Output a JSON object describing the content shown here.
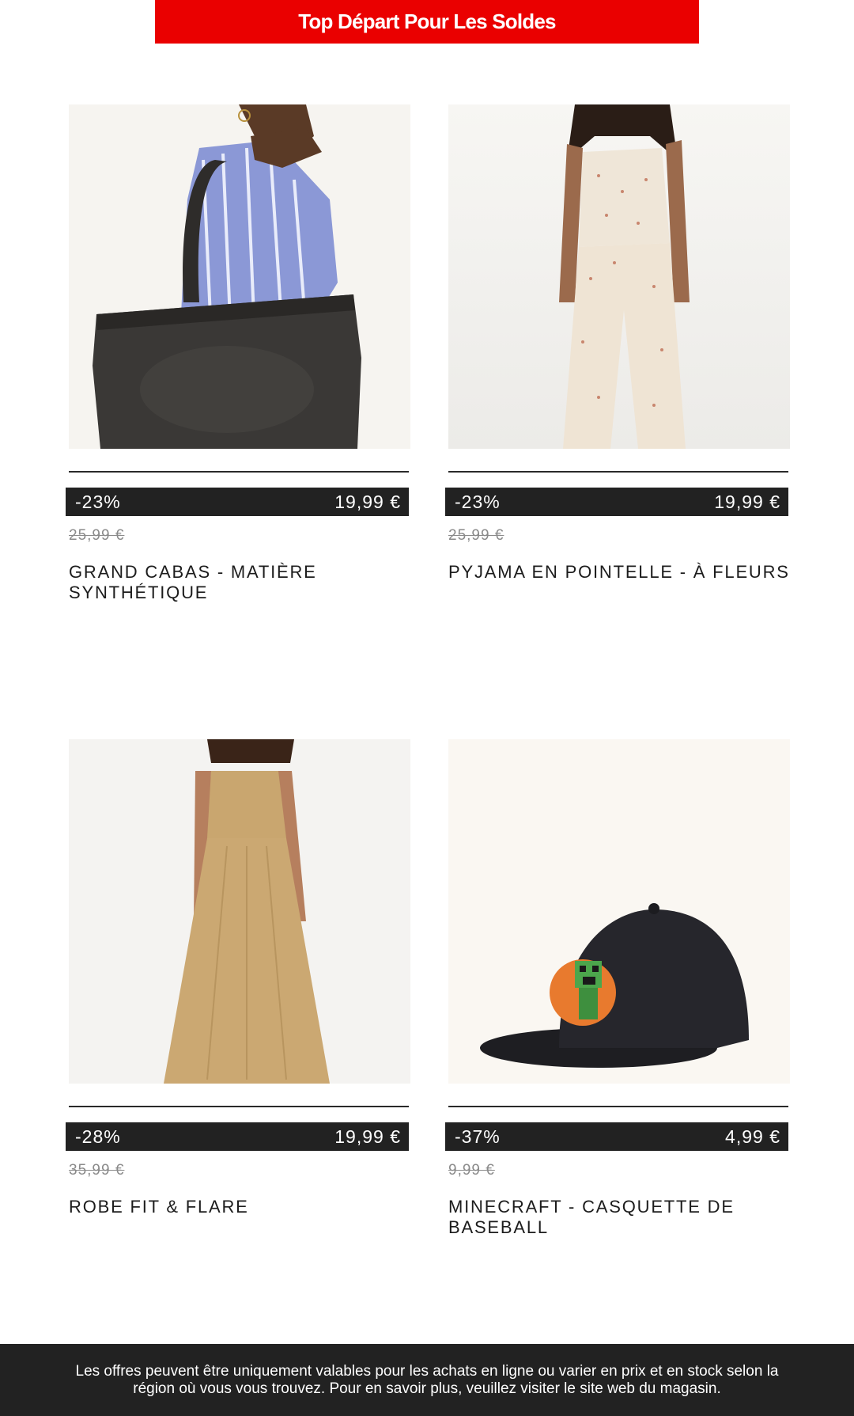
{
  "banner": {
    "label": "Top Départ Pour Les Soldes"
  },
  "products": [
    {
      "discount": "-23%",
      "price": "19,99 €",
      "old_price": "25,99 €",
      "name": "GRAND CABAS - MATIÈRE SYNTHÉTIQUE",
      "image_icon": "tote-bag-photo"
    },
    {
      "discount": "-23%",
      "price": "19,99 €",
      "old_price": "25,99 €",
      "name": "PYJAMA EN POINTELLE - À FLEURS",
      "image_icon": "pyjama-photo"
    },
    {
      "discount": "-28%",
      "price": "19,99 €",
      "old_price": "35,99 €",
      "name": "ROBE FIT & FLARE",
      "image_icon": "dress-photo"
    },
    {
      "discount": "-37%",
      "price": "4,99 €",
      "old_price": "9,99 €",
      "name": "MINECRAFT - CASQUETTE DE BASEBALL",
      "image_icon": "cap-photo"
    }
  ],
  "footer": {
    "text": "Les offres peuvent être uniquement valables pour les achats en ligne ou varier en prix et en stock selon la région où vous vous trouvez. Pour en savoir plus, veuillez visiter le site web du magasin."
  },
  "colors": {
    "banner": "#ea0000",
    "price_bar": "#222222",
    "footer": "#222222"
  }
}
